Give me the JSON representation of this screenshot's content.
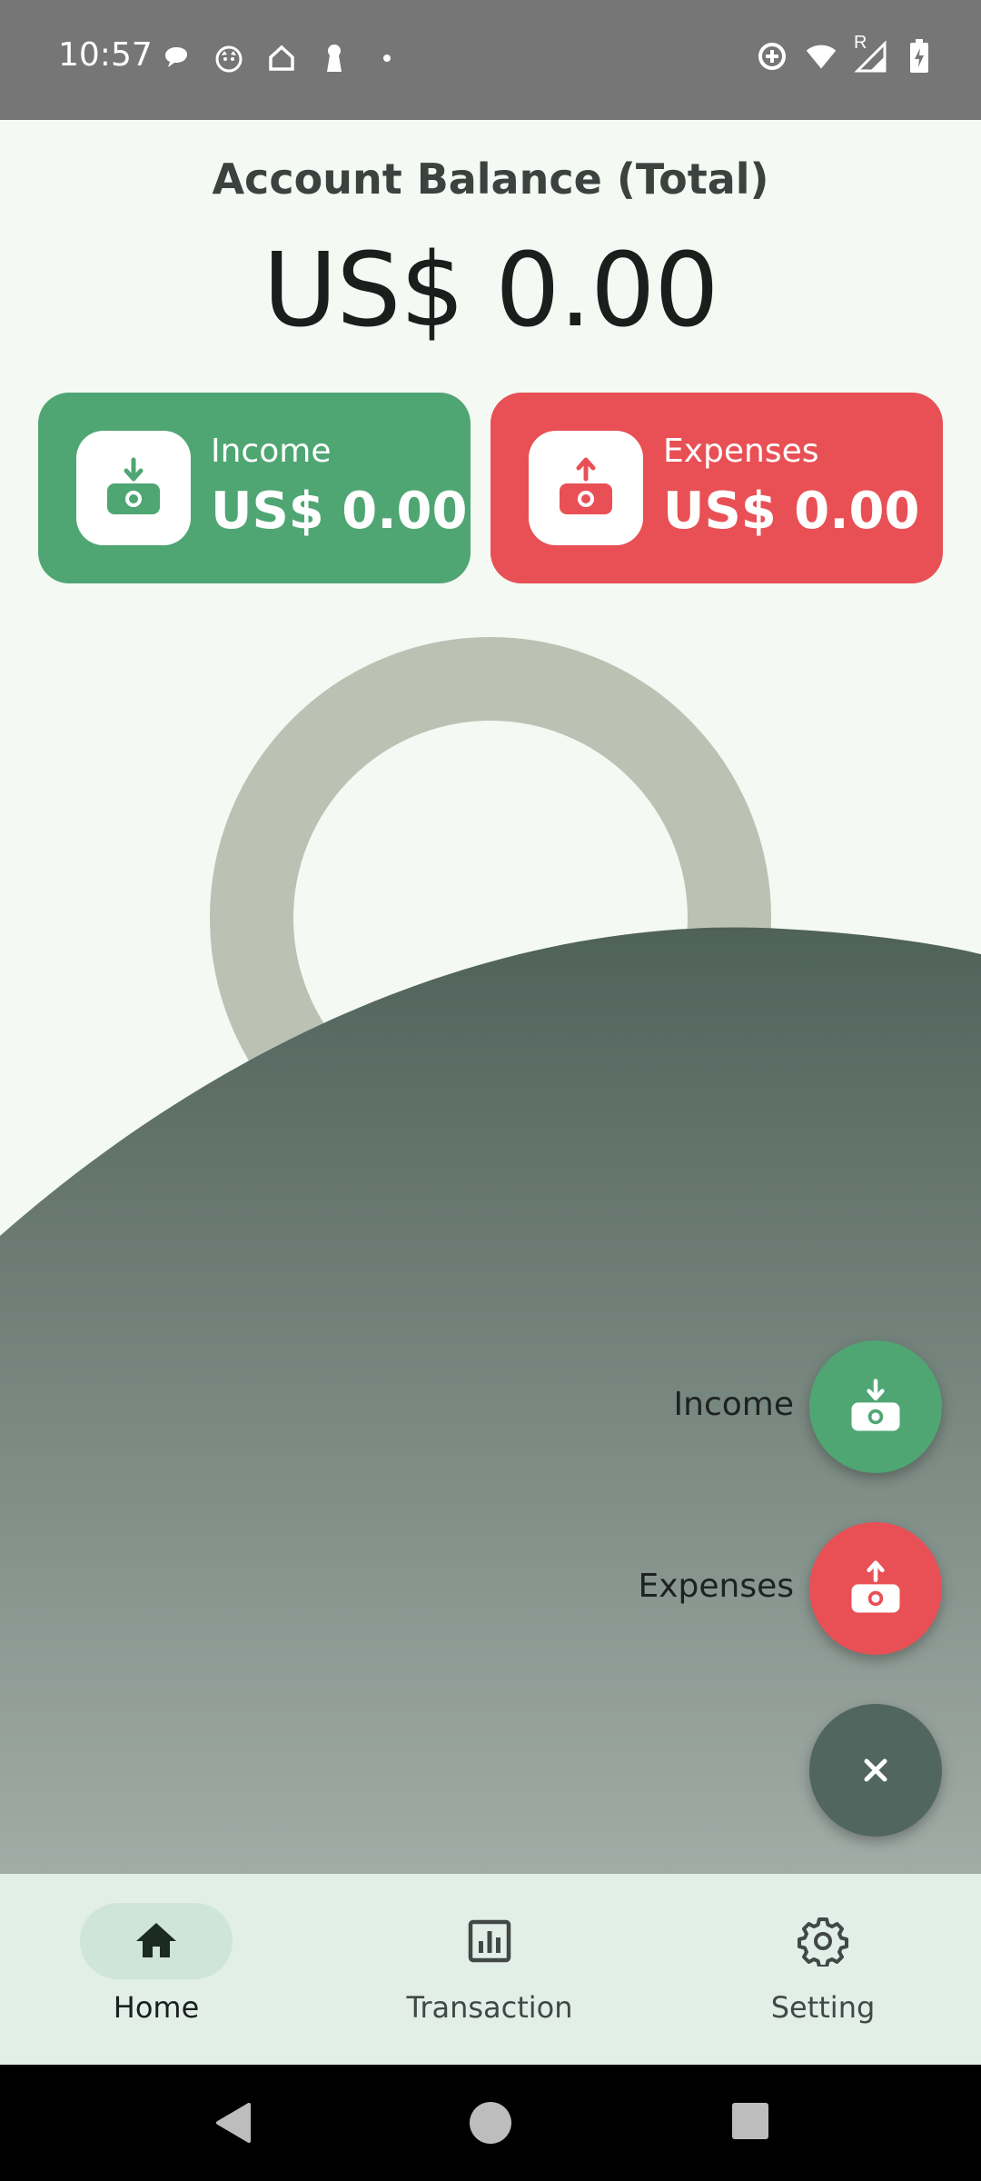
{
  "status_bar": {
    "time": "10:57",
    "left_icons": [
      "chat-bubble-icon",
      "cat-face-icon",
      "home-outline-icon",
      "keyhole-icon",
      "dot-icon"
    ],
    "right_icons": [
      "data-saver-icon",
      "wifi-icon",
      "signal-roaming-icon",
      "battery-charging-icon"
    ],
    "roaming_indicator": "R"
  },
  "header": {
    "title": "Account Balance (Total)",
    "balance": "US$ 0.00"
  },
  "summary_cards": {
    "income": {
      "label": "Income",
      "value": "US$ 0.00",
      "color": "#4fa673"
    },
    "expenses": {
      "label": "Expenses",
      "value": "US$ 0.00",
      "color": "#e85055"
    }
  },
  "speed_dial": {
    "income_label": "Income",
    "expenses_label": "Expenses",
    "close_icon": "close-icon"
  },
  "bottom_nav": {
    "items": [
      {
        "label": "Home",
        "icon": "home-icon",
        "active": true
      },
      {
        "label": "Transaction",
        "icon": "bar-chart-icon",
        "active": false
      },
      {
        "label": "Setting",
        "icon": "gear-icon",
        "active": false
      }
    ]
  },
  "system_nav": [
    "back-icon",
    "home-circle-icon",
    "recents-icon"
  ],
  "colors": {
    "income": "#4fa673",
    "expense": "#e85055",
    "fab_close": "#526660",
    "background": "#f4f9f4",
    "nav_background": "#e2eee8",
    "donut_empty": "#bbc2b3"
  }
}
